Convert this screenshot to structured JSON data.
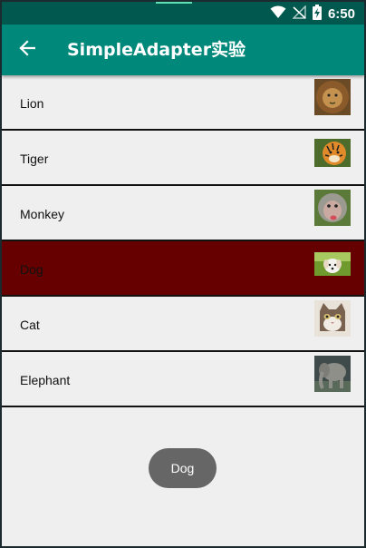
{
  "status_bar": {
    "time": "6:50",
    "icons": [
      "wifi-icon",
      "no-signal-icon",
      "battery-charging-icon"
    ]
  },
  "toolbar": {
    "back_icon": "arrow-left-icon",
    "title": "SimpleAdapter实验",
    "color": "#00897b"
  },
  "list": {
    "items": [
      {
        "label": "Lion",
        "image": "lion-image",
        "selected": false
      },
      {
        "label": "Tiger",
        "image": "tiger-image",
        "selected": false
      },
      {
        "label": "Monkey",
        "image": "monkey-image",
        "selected": false
      },
      {
        "label": "Dog",
        "image": "dog-image",
        "selected": true
      },
      {
        "label": "Cat",
        "image": "cat-image",
        "selected": false
      },
      {
        "label": "Elephant",
        "image": "elephant-image",
        "selected": false
      }
    ],
    "selected_color": "#660000"
  },
  "toast": {
    "text": "Dog"
  }
}
